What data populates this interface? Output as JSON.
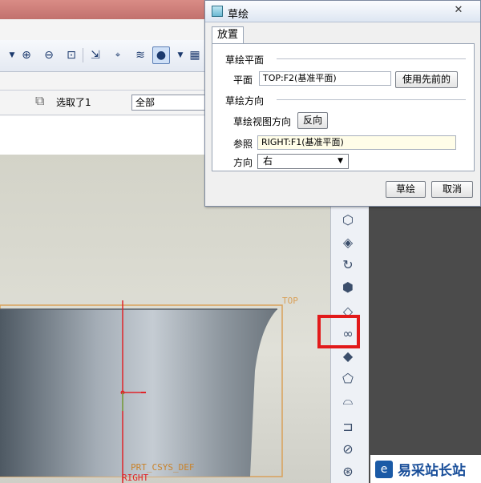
{
  "dialog": {
    "title": "草绘",
    "close_glyph": "✕",
    "tab": "放置",
    "sketch_plane": {
      "group": "草绘平面",
      "plane_label": "平面",
      "plane_value": "TOP:F2(基准平面)",
      "use_previous": "使用先前的"
    },
    "orientation": {
      "group": "草绘方向",
      "view_direction_label": "草绘视图方向",
      "flip": "反向",
      "reference_label": "参照",
      "reference_value": "RIGHT:F1(基准平面)",
      "direction_label": "方向",
      "direction_value": "右"
    },
    "ok": "草绘",
    "cancel": "取消"
  },
  "filter": {
    "selected_text": "选取了1",
    "filter_value": "全部"
  },
  "viewport": {
    "top_plane": "TOP",
    "right_plane": "RIGHT",
    "csys_label": "PRT_CSYS_DEF"
  },
  "watermark": {
    "logo": "e",
    "text": "易采站长站"
  },
  "colors": {
    "highlight": "#e21a1a",
    "datum": "#d9a15a",
    "axis": "#e0242a"
  }
}
